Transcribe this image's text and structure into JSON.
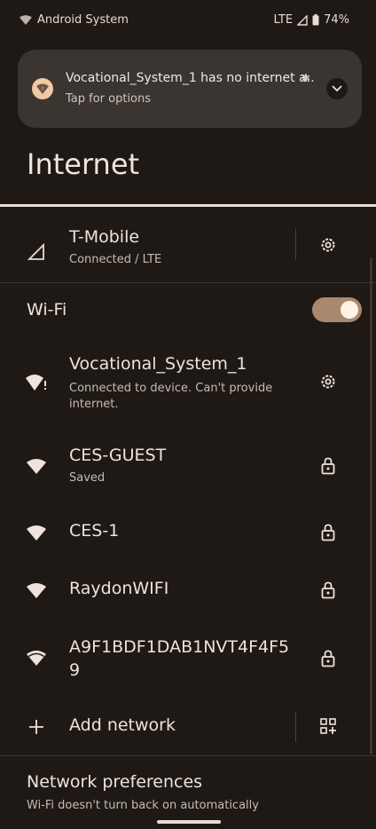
{
  "status_bar": {
    "source": "Android System",
    "network": "LTE",
    "battery": "74%"
  },
  "notification": {
    "title": "Vocational_System_1 has no internet a..",
    "subtitle": "Tap for options"
  },
  "page": {
    "title": "Internet"
  },
  "mobile": {
    "name": "T-Mobile",
    "status": "Connected / LTE"
  },
  "wifi": {
    "label": "Wi-Fi",
    "enabled": true,
    "networks": [
      {
        "name": "Vocational_System_1",
        "status": "Connected to device. Can't provide internet.",
        "icon": "wifi-warning-icon",
        "action": "gear-icon"
      },
      {
        "name": "CES-GUEST",
        "status": "Saved",
        "icon": "wifi-icon",
        "action": "lock-icon"
      },
      {
        "name": "CES-1",
        "status": "",
        "icon": "wifi-icon",
        "action": "lock-icon"
      },
      {
        "name": "RaydonWIFI",
        "status": "",
        "icon": "wifi-icon",
        "action": "lock-icon"
      },
      {
        "name": "A9F1BDF1DAB1NVT4F4F5\n9",
        "status": "",
        "icon": "wifi-icon",
        "action": "lock-icon"
      }
    ],
    "add_network": "Add network"
  },
  "preferences": {
    "title": "Network preferences",
    "subtitle": "Wi-Fi doesn't turn back on automatically"
  },
  "colors": {
    "background": "#1e1915",
    "notification_bg": "#3a3531",
    "toggle_on": "#a9896d",
    "accent_icon": "#f0c9a5"
  }
}
